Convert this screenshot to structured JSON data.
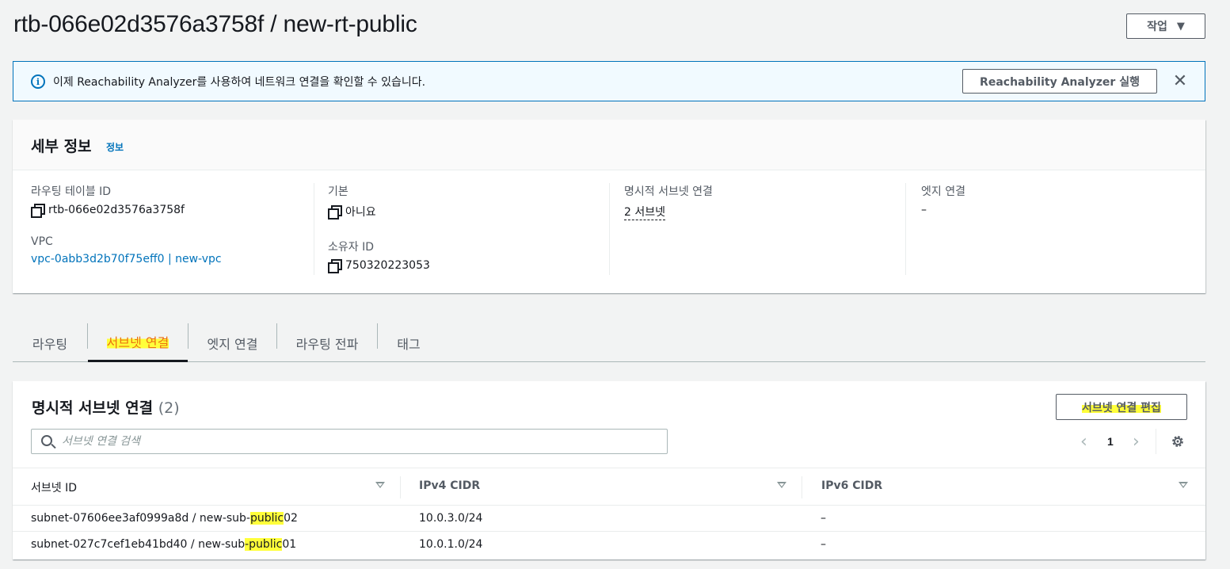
{
  "header": {
    "title": "rtb-066e02d3576a3758f / new-rt-public",
    "actions_label": "작업"
  },
  "banner": {
    "text": "이제 Reachability Analyzer를 사용하여 네트워크 연결을 확인할 수 있습니다.",
    "button_label": "Reachability Analyzer 실행"
  },
  "details": {
    "title": "세부 정보",
    "info_link": "정보",
    "route_table_id_label": "라우팅 테이블 ID",
    "route_table_id": "rtb-066e02d3576a3758f",
    "vpc_label": "VPC",
    "vpc_value": "vpc-0abb3d2b70f75eff0 | new-vpc",
    "main_label": "기본",
    "main_value": "아니요",
    "owner_label": "소유자 ID",
    "owner_value": "750320223053",
    "explicit_label": "명시적 서브넷 연결",
    "explicit_value": "2 서브넷",
    "edge_label": "엣지 연결",
    "edge_value": "–"
  },
  "tabs": [
    {
      "label": "라우팅"
    },
    {
      "label": "서브넷 연결"
    },
    {
      "label": "엣지 연결"
    },
    {
      "label": "라우팅 전파"
    },
    {
      "label": "태그"
    }
  ],
  "subnets": {
    "title": "명시적 서브넷 연결",
    "count": "(2)",
    "edit_label": "서브넷 연결 편집",
    "search_placeholder": "서브넷 연결 검색",
    "page": "1",
    "columns": [
      "서브넷 ID",
      "IPv4 CIDR",
      "IPv6 CIDR"
    ],
    "rows": [
      {
        "subnet_prefix": "subnet-07606ee3af0999a8d / new-sub-",
        "subnet_hl": "public",
        "subnet_suffix": "02",
        "ipv4": "10.0.3.0/24",
        "ipv6": "–"
      },
      {
        "subnet_prefix": "subnet-027c7cef1eb41bd40 / new-sub",
        "subnet_hl": "-public",
        "subnet_suffix": "01",
        "ipv4": "10.0.1.0/24",
        "ipv6": "–"
      }
    ]
  },
  "colors": {
    "link": "#0073bb",
    "active_tab": "#ec7211",
    "highlight": "#ffff3a"
  }
}
